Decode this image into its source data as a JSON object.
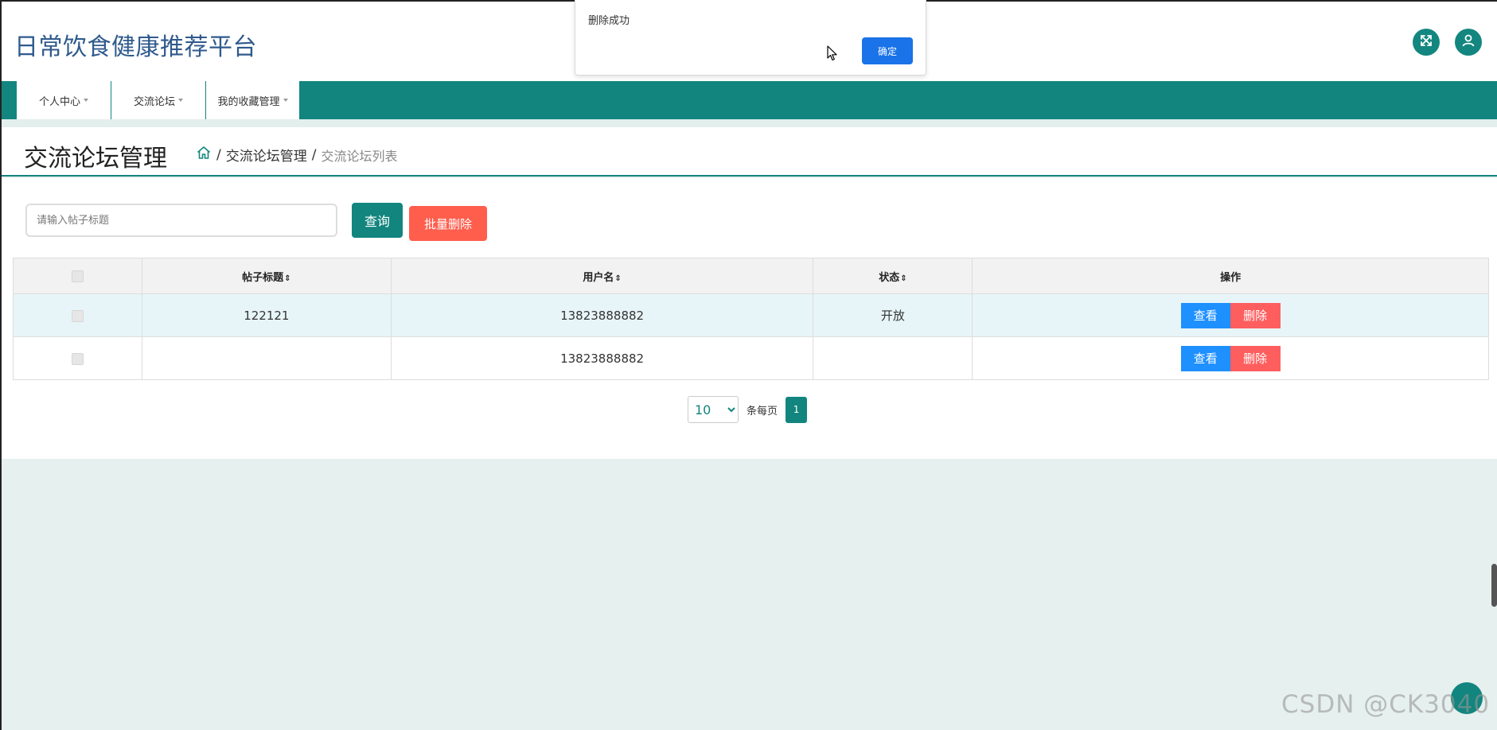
{
  "header": {
    "site_title": "日常饮食健康推荐平台"
  },
  "nav": {
    "items": [
      {
        "label": "个人中心"
      },
      {
        "label": "交流论坛"
      },
      {
        "label": "我的收藏管理"
      }
    ]
  },
  "page": {
    "title": "交流论坛管理",
    "breadcrumb": {
      "sep": "/",
      "level1": "交流论坛管理",
      "current": "交流论坛列表"
    }
  },
  "search": {
    "placeholder": "请输入帖子标题",
    "query_label": "查询",
    "batch_delete_label": "批量删除"
  },
  "table": {
    "columns": [
      {
        "label": "帖子标题",
        "sortable": true
      },
      {
        "label": "用户名",
        "sortable": true
      },
      {
        "label": "状态",
        "sortable": true
      },
      {
        "label": "操作",
        "sortable": false
      }
    ],
    "sort_icon": "⇕",
    "rows": [
      {
        "title": "122121",
        "username": "13823888882",
        "status": "开放",
        "view_label": "查看",
        "delete_label": "删除"
      },
      {
        "title": "",
        "username": "13823888882",
        "status": "",
        "view_label": "查看",
        "delete_label": "删除"
      }
    ]
  },
  "pagination": {
    "page_size": "10",
    "page_size_options": [
      "10"
    ],
    "per_page_label": "条每页",
    "current_page": "1"
  },
  "dialog": {
    "message": "删除成功",
    "ok_label": "确定"
  },
  "watermark": "CSDN @CK3040",
  "colors": {
    "primary": "#12857e",
    "danger": "#ff5e5e",
    "info": "#1e90ff",
    "title": "#2f5a8c"
  },
  "icons": {
    "fullscreen": "fullscreen-icon",
    "user": "user-icon",
    "home": "home-icon"
  }
}
